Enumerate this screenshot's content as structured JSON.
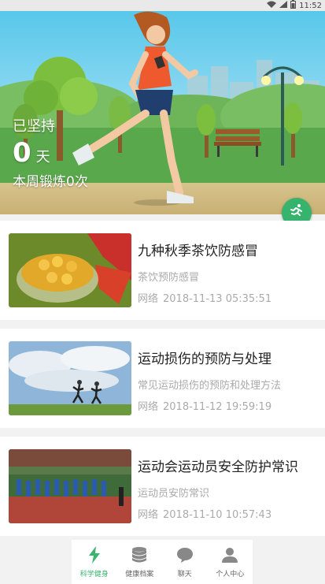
{
  "status_bar": {
    "time": "11:52"
  },
  "hero": {
    "kept_label": "已坚持",
    "days_value": "0",
    "days_unit": "天",
    "week_text": "本周锻炼0次"
  },
  "articles": [
    {
      "title": "九种秋季茶饮防感冒",
      "summary": "茶饮预防感冒",
      "source": "网络",
      "datetime": "2018-11-13 05:35:51",
      "thumb": "tea-cup-image"
    },
    {
      "title": "运动损伤的预防与处理",
      "summary": "常见运动损伤的预防和处理方法",
      "source": "网络",
      "datetime": "2018-11-12 19:59:19",
      "thumb": "runners-image"
    },
    {
      "title": "运动会运动员安全防护常识",
      "summary": "运动员安防常识",
      "source": "网络",
      "datetime": "2018-11-10 10:57:43",
      "thumb": "sports-meet-image"
    }
  ],
  "tabs": [
    {
      "label": "科学健身",
      "icon": "lightning-icon",
      "active": true
    },
    {
      "label": "健康档案",
      "icon": "database-icon",
      "active": false
    },
    {
      "label": "聊天",
      "icon": "chat-bubble-icon",
      "active": false
    },
    {
      "label": "个人中心",
      "icon": "person-icon",
      "active": false
    }
  ],
  "colors": {
    "accent": "#3ab36e",
    "hero_sky": "#58c7ea"
  }
}
